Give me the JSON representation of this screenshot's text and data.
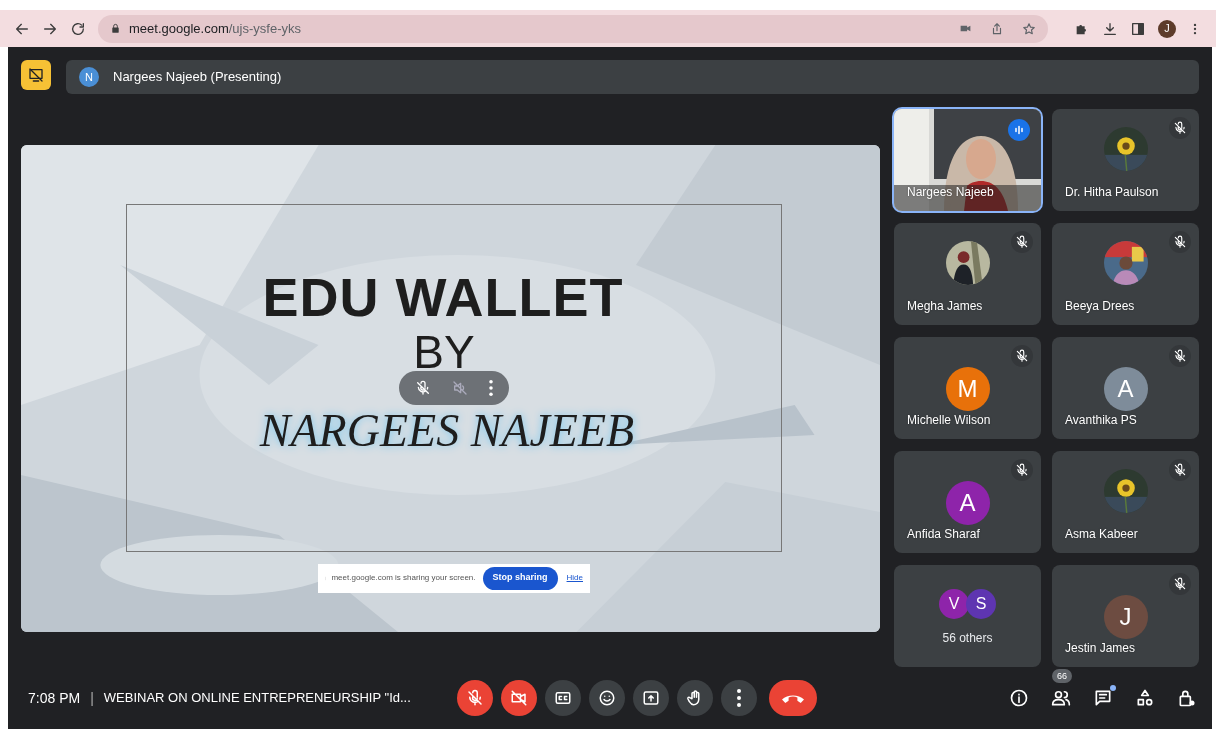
{
  "browser": {
    "url_host": "meet.google.com",
    "url_path": "/ujs-ysfe-yks",
    "profile_initial": "J"
  },
  "presenter_bar": {
    "initial": "N",
    "label": "Nargees Najeeb (Presenting)"
  },
  "slide": {
    "title": "EDU WALLET",
    "by": "BY",
    "author": "NARGEES NAJEEB"
  },
  "share_notice": {
    "text": "meet.google.com is sharing your screen.",
    "stop": "Stop sharing",
    "hide": "Hide"
  },
  "participants": [
    {
      "kind": "video",
      "name": "Nargees Najeeb",
      "speaking": true,
      "muted": false
    },
    {
      "name": "Dr. Hitha Paulson",
      "speaking": false,
      "muted": true
    },
    {
      "name": "Megha James",
      "speaking": false,
      "muted": true
    },
    {
      "name": "Beeya Drees",
      "speaking": false,
      "muted": true
    },
    {
      "kind": "letter",
      "name": "Michelle Wilson",
      "letter": "M",
      "color": "#e8710a",
      "speaking": false,
      "muted": true
    },
    {
      "kind": "letter",
      "name": "Avanthika PS",
      "letter": "A",
      "color": "#7e8c9a",
      "speaking": false,
      "muted": true
    },
    {
      "kind": "letter",
      "name": "Anfida Sharaf",
      "letter": "A",
      "color": "#8e24aa",
      "speaking": false,
      "muted": true
    },
    {
      "name": "Asma Kabeer",
      "speaking": false,
      "muted": true
    },
    {
      "kind": "others",
      "label": "56 others",
      "letters": [
        {
          "letter": "V",
          "color": "#8e24aa"
        },
        {
          "letter": "S",
          "color": "#5e35b1"
        }
      ]
    },
    {
      "kind": "letter",
      "name": "Jestin James",
      "letter": "J",
      "color": "#6d4c41",
      "speaking": false,
      "muted": true
    }
  ],
  "bottom_bar": {
    "time": "7:08 PM",
    "separator": "|",
    "meeting_title": "WEBINAR ON ONLINE ENTREPRENEURSHIP \"Id...",
    "people_count": "66",
    "chat_unread": true
  },
  "controls": [
    {
      "kind": "mic",
      "off": true
    },
    {
      "kind": "camera",
      "off": true
    },
    {
      "kind": "captions",
      "off": false
    },
    {
      "kind": "emoji",
      "off": false
    },
    {
      "kind": "present",
      "off": false
    },
    {
      "kind": "hand",
      "off": false
    },
    {
      "kind": "more",
      "off": false
    },
    {
      "kind": "end",
      "off": true
    }
  ]
}
